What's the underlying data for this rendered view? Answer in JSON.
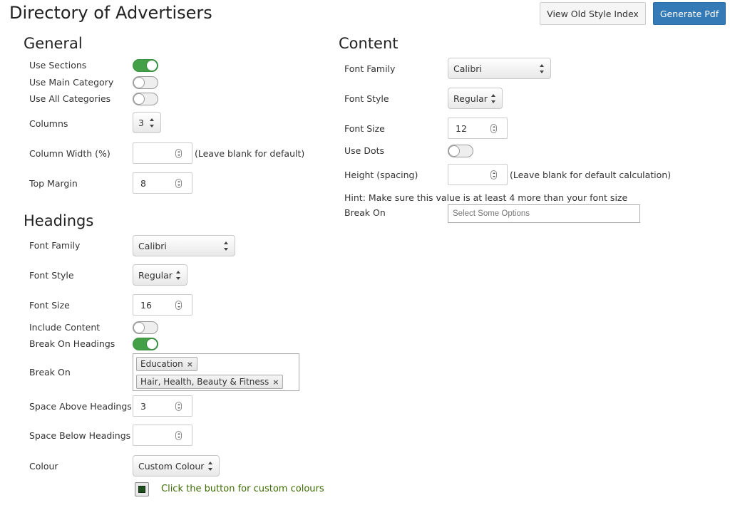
{
  "page": {
    "title": "Directory of Advertisers"
  },
  "toolbar": {
    "view_old_label": "View Old Style Index",
    "generate_label": "Generate Pdf"
  },
  "general": {
    "title": "General",
    "use_sections": {
      "label": "Use Sections",
      "on": true
    },
    "use_main_category": {
      "label": "Use Main Category",
      "on": false
    },
    "use_all_categories": {
      "label": "Use All Categories",
      "on": false
    },
    "columns": {
      "label": "Columns",
      "value": "3"
    },
    "column_width": {
      "label": "Column Width (%)",
      "value": "",
      "hint": "(Leave blank for default)"
    },
    "top_margin": {
      "label": "Top Margin",
      "value": "8"
    }
  },
  "headings": {
    "title": "Headings",
    "font_family": {
      "label": "Font Family",
      "value": "Calibri"
    },
    "font_style": {
      "label": "Font Style",
      "value": "Regular"
    },
    "font_size": {
      "label": "Font Size",
      "value": "16"
    },
    "include_content": {
      "label": "Include Content",
      "on": false
    },
    "break_on_headings": {
      "label": "Break On Headings",
      "on": true
    },
    "break_on": {
      "label": "Break On",
      "chips": [
        "Education",
        "Hair, Health, Beauty & Fitness"
      ],
      "remove_glyph": "×"
    },
    "space_above": {
      "label": "Space Above Headings",
      "value": "3"
    },
    "space_below": {
      "label": "Space Below Headings",
      "value": ""
    },
    "colour": {
      "label": "Colour",
      "value": "Custom Colour",
      "hint": "Click the button for custom colours",
      "swatch": "#1e4d1e"
    }
  },
  "content": {
    "title": "Content",
    "font_family": {
      "label": "Font Family",
      "value": "Calibri"
    },
    "font_style": {
      "label": "Font Style",
      "value": "Regular"
    },
    "font_size": {
      "label": "Font Size",
      "value": "12"
    },
    "use_dots": {
      "label": "Use Dots",
      "on": false
    },
    "height": {
      "label": "Height (spacing)",
      "value": "",
      "hint": "(Leave blank for default calculation)"
    },
    "hint_text": "Hint: Make sure this value is at least 4 more than your font size",
    "break_on": {
      "label": "Break On",
      "placeholder": "Select Some Options"
    }
  },
  "colors": {
    "primary": "#337ab7",
    "toggle_on": "#43a047",
    "hint_green": "#3c6b00"
  }
}
